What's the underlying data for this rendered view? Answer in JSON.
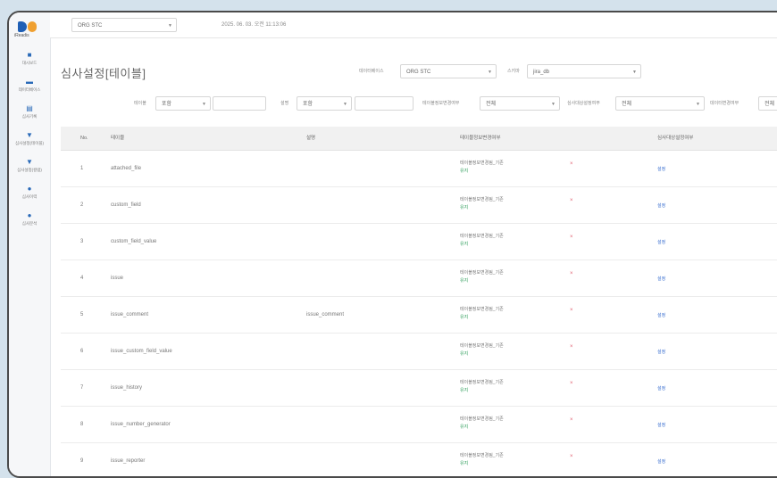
{
  "sidebar": {
    "logo_text": "iReadis",
    "items": [
      {
        "icon": "dashboard-icon",
        "label": "대시보드"
      },
      {
        "icon": "folder-icon",
        "label": "데이터베이스"
      },
      {
        "icon": "document-icon",
        "label": "심사기록"
      },
      {
        "icon": "settings-icon",
        "label": "심사설정(테이블)"
      },
      {
        "icon": "settings-icon",
        "label": "심사설정(컬럼)"
      },
      {
        "icon": "user-icon",
        "label": "심사이력"
      },
      {
        "icon": "user-icon",
        "label": "심사분석"
      }
    ]
  },
  "topbar": {
    "db_select": "ORG STC",
    "datetime": "2025. 06. 03. 오전 11:13:06"
  },
  "page": {
    "title": "심사설정[테이블]"
  },
  "filters": {
    "row1": {
      "db_label": "데이터베이스",
      "db_value": "ORG STC",
      "schema_label": "스키마",
      "schema_value": "jira_db"
    },
    "row2": {
      "table_label": "테이블",
      "table_select": "포함",
      "desc_label": "설명",
      "desc_select": "포함",
      "f3_label": "테이블정보변경여부",
      "f3_value": "전체",
      "f4_label": "심사대상설정여부",
      "f4_value": "전체",
      "f5_label": "데이터변경여부",
      "f5_value": "전체"
    }
  },
  "table": {
    "headers": [
      "No.",
      "테이블",
      "설명",
      "테이블정보변경여부",
      "심사대상설정여부"
    ],
    "rows": [
      {
        "no": "1",
        "name": "attached_file",
        "desc": "",
        "status": "테이블정보변경됨_기존",
        "tag": "유지",
        "flag": "×",
        "link": "설정"
      },
      {
        "no": "2",
        "name": "custom_field",
        "desc": "",
        "status": "테이블정보변경됨_기존",
        "tag": "유지",
        "flag": "×",
        "link": "설정"
      },
      {
        "no": "3",
        "name": "custom_field_value",
        "desc": "",
        "status": "테이블정보변경됨_기존",
        "tag": "유지",
        "flag": "×",
        "link": "설정"
      },
      {
        "no": "4",
        "name": "issue",
        "desc": "",
        "status": "테이블정보변경됨_기존",
        "tag": "유지",
        "flag": "×",
        "link": "설정"
      },
      {
        "no": "5",
        "name": "issue_comment",
        "desc": "issue_comment",
        "status": "테이블정보변경됨_기존",
        "tag": "유지",
        "flag": "×",
        "link": "설정"
      },
      {
        "no": "6",
        "name": "issue_custom_field_value",
        "desc": "",
        "status": "테이블정보변경됨_기존",
        "tag": "유지",
        "flag": "×",
        "link": "설정"
      },
      {
        "no": "7",
        "name": "issue_history",
        "desc": "",
        "status": "테이블정보변경됨_기존",
        "tag": "유지",
        "flag": "×",
        "link": "설정"
      },
      {
        "no": "8",
        "name": "issue_number_generator",
        "desc": "",
        "status": "테이블정보변경됨_기존",
        "tag": "유지",
        "flag": "×",
        "link": "설정"
      },
      {
        "no": "9",
        "name": "issue_reporter",
        "desc": "",
        "status": "테이블정보변경됨_기존",
        "tag": "유지",
        "flag": "×",
        "link": "설정"
      }
    ]
  }
}
